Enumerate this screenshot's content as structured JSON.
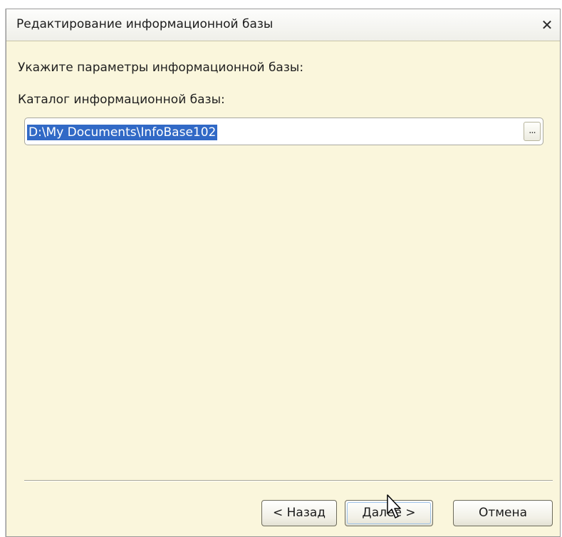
{
  "dialog": {
    "title": "Редактирование информационной базы",
    "close_glyph": "✕"
  },
  "content": {
    "heading": "Укажите параметры информационной базы:",
    "catalog_label": "Каталог информационной базы:",
    "catalog_value": "D:\\My Documents\\InfoBase102",
    "browse_label": "..."
  },
  "buttons": {
    "back": "< Назад",
    "next": "Далее >",
    "cancel": "Отмена"
  },
  "colors": {
    "dialog_background": "#faf6dc",
    "selection": "#3169c6",
    "focus_ring": "#9ec2e8"
  },
  "icons": {
    "close": "close-icon",
    "cursor": "mouse-pointer-icon"
  }
}
